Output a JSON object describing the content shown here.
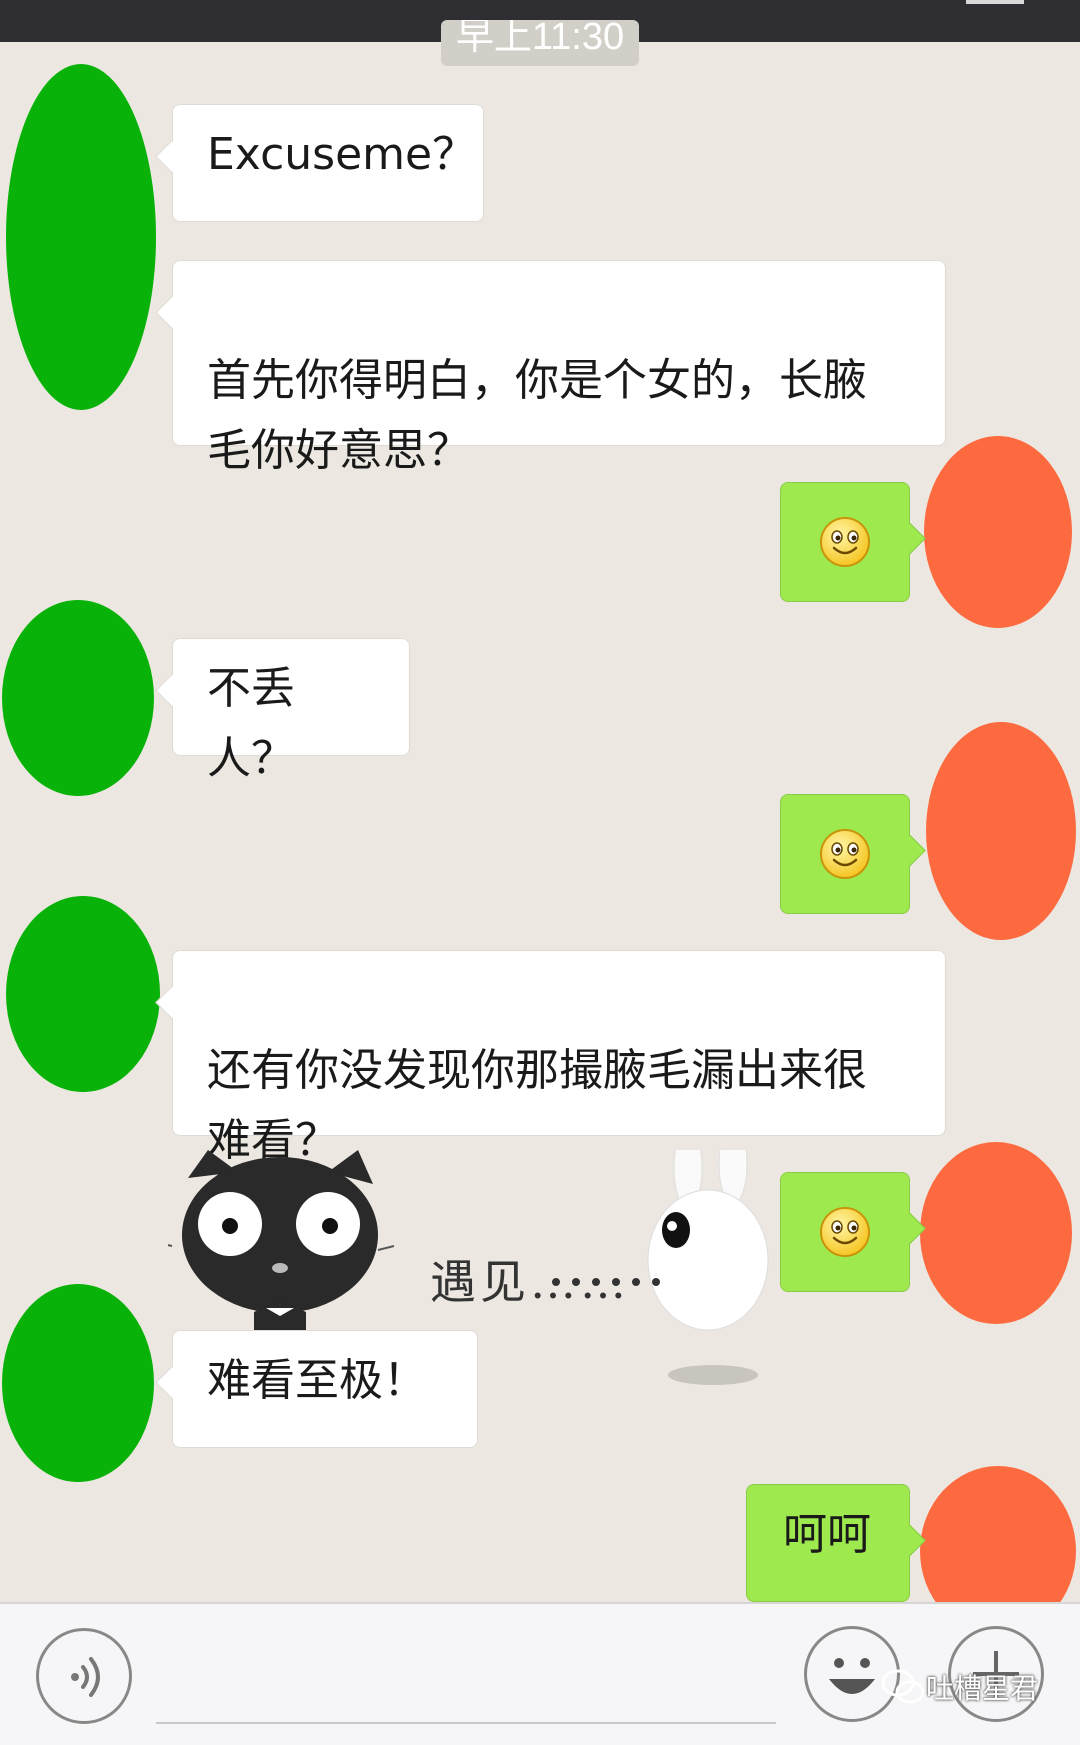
{
  "chat": {
    "timestamp": "早上11:30",
    "messages": [
      {
        "from": "other",
        "type": "text",
        "text": "Excuseme？"
      },
      {
        "from": "other",
        "type": "text",
        "text": "首先你得明白，你是个女的，长腋\n毛你好意思？"
      },
      {
        "from": "me",
        "type": "emoji",
        "emoji": "smiley"
      },
      {
        "from": "other",
        "type": "text",
        "text": "不丢人？"
      },
      {
        "from": "me",
        "type": "emoji",
        "emoji": "smiley"
      },
      {
        "from": "other",
        "type": "text",
        "text": "还有你没发现你那撮腋毛漏出来很\n难看？"
      },
      {
        "from": "other",
        "type": "sticker",
        "caption": "遇见……"
      },
      {
        "from": "me",
        "type": "emoji",
        "emoji": "smiley"
      },
      {
        "from": "other",
        "type": "text",
        "text": "难看至极！"
      },
      {
        "from": "me",
        "type": "text",
        "text": "呵呵"
      }
    ]
  },
  "input_bar": {
    "voice_icon": "voice-icon",
    "emoji_icon": "emoji-icon",
    "add_icon": "plus-icon"
  },
  "watermark": {
    "text": "吐槽星君",
    "icon": "wechat-icon"
  },
  "colors": {
    "background": "#ece8e1",
    "other_avatar": "#09b209",
    "my_avatar": "#fe6a40",
    "my_bubble": "#9ee94e",
    "their_bubble": "#ffffff"
  }
}
